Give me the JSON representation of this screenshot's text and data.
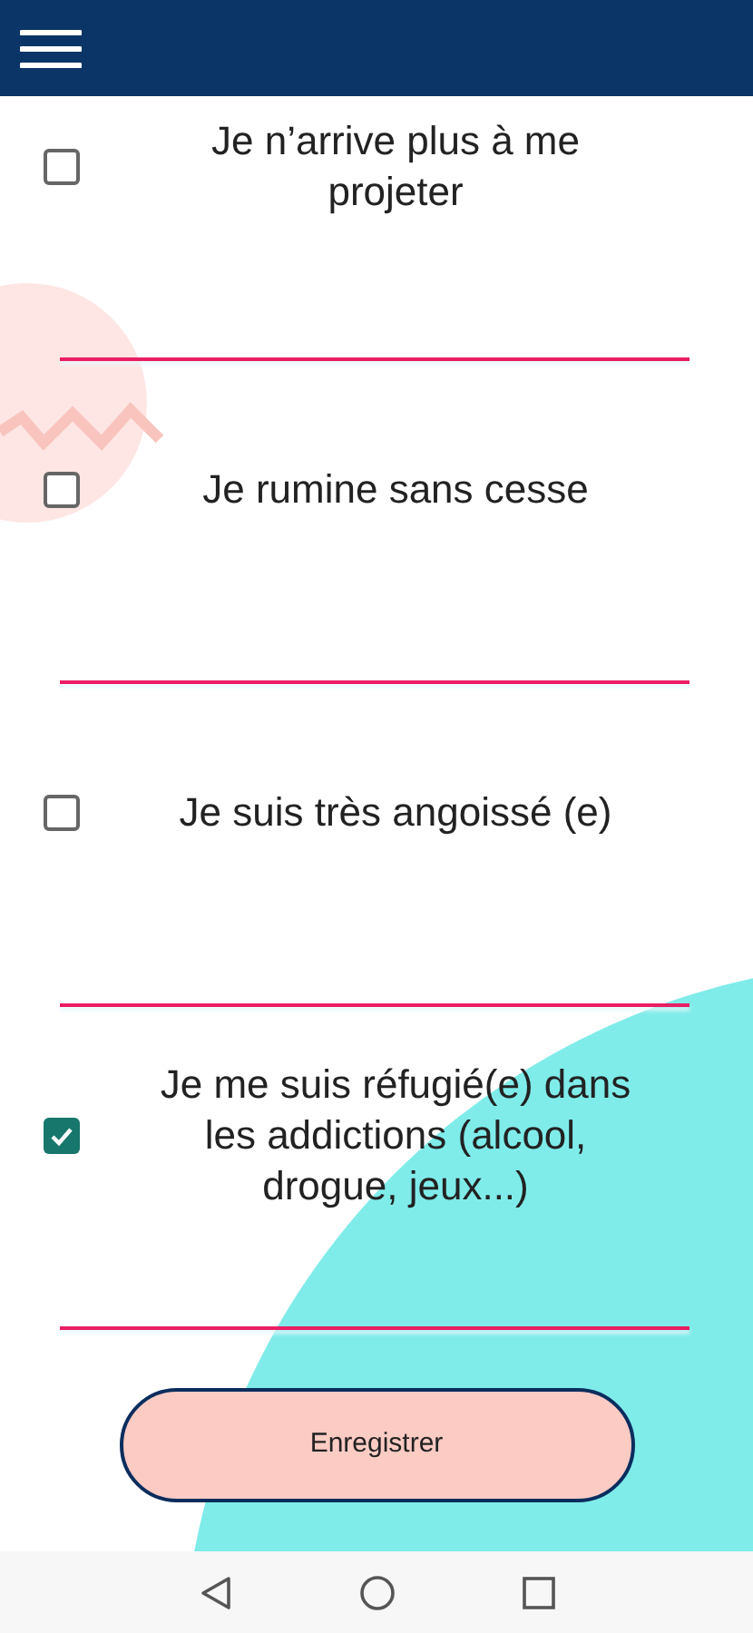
{
  "items": [
    {
      "label": "Je n’arrive plus à me projeter",
      "checked": false
    },
    {
      "label": "Je rumine sans cesse",
      "checked": false
    },
    {
      "label": "Je suis très angoissé (e)",
      "checked": false
    },
    {
      "label": "Je me suis réfugié(e) dans les addictions (alcool, drogue, jeux...)",
      "checked": true
    }
  ],
  "save_button": {
    "label": "Enregistrer"
  }
}
